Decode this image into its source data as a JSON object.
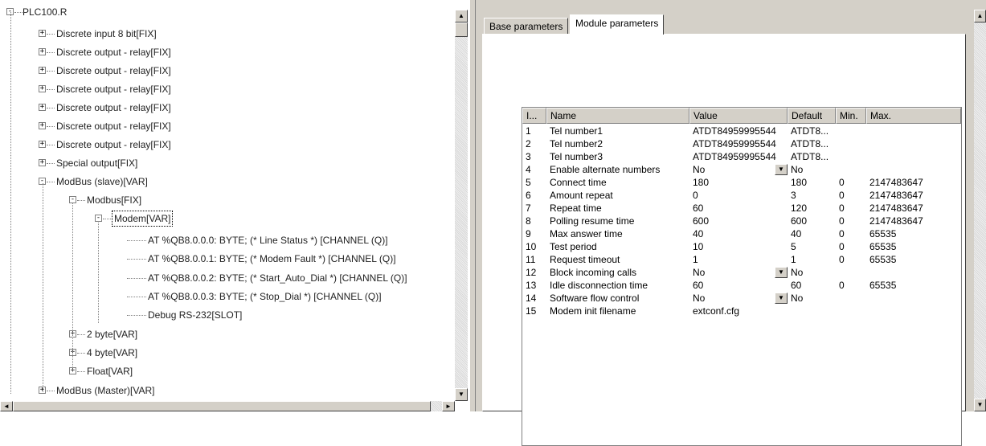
{
  "tree": {
    "root": "PLC100.R",
    "nodes": [
      {
        "label": "Discrete input 8 bit[FIX]",
        "box": "+"
      },
      {
        "label": "Discrete output - relay[FIX]",
        "box": "+"
      },
      {
        "label": "Discrete output - relay[FIX]",
        "box": "+"
      },
      {
        "label": "Discrete output - relay[FIX]",
        "box": "+"
      },
      {
        "label": "Discrete output - relay[FIX]",
        "box": "+"
      },
      {
        "label": "Discrete output - relay[FIX]",
        "box": "+"
      },
      {
        "label": "Discrete output - relay[FIX]",
        "box": "+"
      },
      {
        "label": "Special output[FIX]",
        "box": "+"
      },
      {
        "label": "ModBus (slave)[VAR]",
        "box": "-"
      },
      {
        "label": "Modbus[FIX]",
        "box": "-"
      },
      {
        "label": "Modem[VAR]",
        "box": "-"
      },
      {
        "label": "AT %QB8.0.0.0: BYTE; (* Line Status *) [CHANNEL (Q)]",
        "box": ""
      },
      {
        "label": "AT %QB8.0.0.1: BYTE; (* Modem Fault *) [CHANNEL (Q)]",
        "box": ""
      },
      {
        "label": "AT %QB8.0.0.2: BYTE; (* Start_Auto_Dial *) [CHANNEL (Q)]",
        "box": ""
      },
      {
        "label": "AT %QB8.0.0.3: BYTE; (* Stop_Dial *) [CHANNEL (Q)]",
        "box": ""
      },
      {
        "label": "Debug RS-232[SLOT]",
        "box": ""
      },
      {
        "label": "2 byte[VAR]",
        "box": "+"
      },
      {
        "label": "4 byte[VAR]",
        "box": "+"
      },
      {
        "label": "Float[VAR]",
        "box": "+"
      },
      {
        "label": "ModBus (Master)[VAR]",
        "box": "+"
      }
    ]
  },
  "tabs": [
    {
      "label": "Base parameters",
      "active": false
    },
    {
      "label": "Module parameters",
      "active": true
    }
  ],
  "grid": {
    "columns": [
      "I...",
      "Name",
      "Value",
      "Default",
      "Min.",
      "Max."
    ],
    "rows": [
      {
        "index": "1",
        "name": "Tel number1",
        "value": "ATDT84959995544",
        "default": "ATDT8...",
        "min": "",
        "max": "",
        "dropdown": false
      },
      {
        "index": "2",
        "name": "Tel number2",
        "value": "ATDT84959995544",
        "default": "ATDT8...",
        "min": "",
        "max": "",
        "dropdown": false
      },
      {
        "index": "3",
        "name": "Tel number3",
        "value": "ATDT84959995544",
        "default": "ATDT8...",
        "min": "",
        "max": "",
        "dropdown": false
      },
      {
        "index": "4",
        "name": "Enable alternate numbers",
        "value": "No",
        "default": "No",
        "min": "",
        "max": "",
        "dropdown": true
      },
      {
        "index": "5",
        "name": "Connect time",
        "value": "180",
        "default": "180",
        "min": "0",
        "max": "2147483647",
        "dropdown": false
      },
      {
        "index": "6",
        "name": "Amount repeat",
        "value": "0",
        "default": "3",
        "min": "0",
        "max": "2147483647",
        "dropdown": false
      },
      {
        "index": "7",
        "name": "Repeat time",
        "value": "60",
        "default": "120",
        "min": "0",
        "max": "2147483647",
        "dropdown": false
      },
      {
        "index": "8",
        "name": "Polling resume time",
        "value": "600",
        "default": "600",
        "min": "0",
        "max": "2147483647",
        "dropdown": false
      },
      {
        "index": "9",
        "name": "Max answer time",
        "value": "40",
        "default": "40",
        "min": "0",
        "max": "65535",
        "dropdown": false
      },
      {
        "index": "10",
        "name": "Test period",
        "value": "10",
        "default": "5",
        "min": "0",
        "max": "65535",
        "dropdown": false
      },
      {
        "index": "11",
        "name": "Request timeout",
        "value": "1",
        "default": "1",
        "min": "0",
        "max": "65535",
        "dropdown": false
      },
      {
        "index": "12",
        "name": "Block incoming calls",
        "value": "No",
        "default": "No",
        "min": "",
        "max": "",
        "dropdown": true
      },
      {
        "index": "13",
        "name": "Idle disconnection time",
        "value": "60",
        "default": "60",
        "min": "0",
        "max": "65535",
        "dropdown": false
      },
      {
        "index": "14",
        "name": "Software flow control",
        "value": "No",
        "default": "No",
        "min": "",
        "max": "",
        "dropdown": true
      },
      {
        "index": "15",
        "name": "Modem init filename",
        "value": "extconf.cfg",
        "default": "",
        "min": "",
        "max": "",
        "dropdown": false
      }
    ]
  },
  "icons": {
    "scroll_up": "▲",
    "scroll_down": "▼",
    "scroll_left": "◄",
    "scroll_right": "►",
    "dropdown": "▼"
  }
}
